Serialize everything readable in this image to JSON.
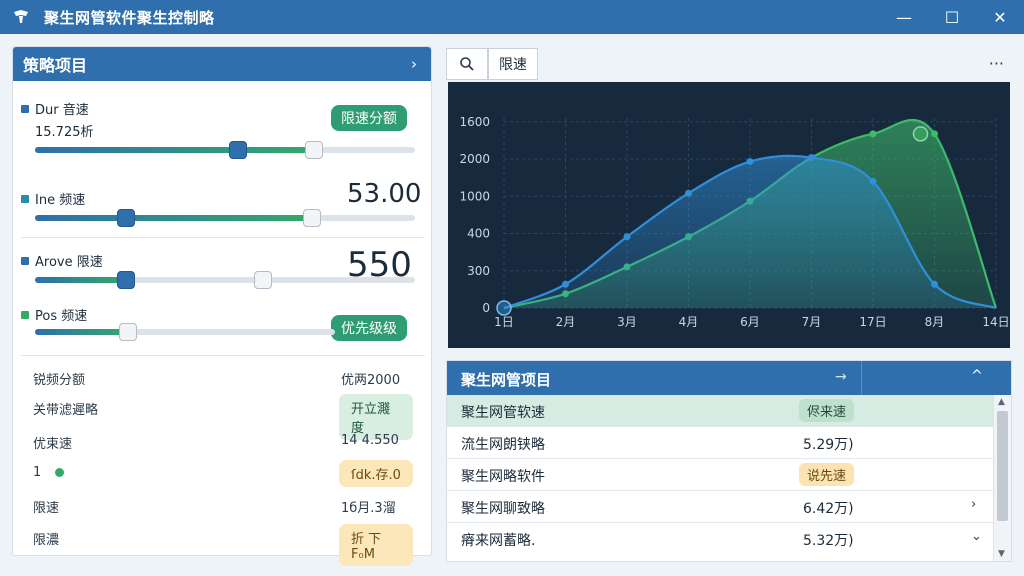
{
  "window": {
    "title": "聚生网管软件聚生控制略",
    "buttons": {
      "minimize": "—",
      "maximize": "☐",
      "close": "✕"
    }
  },
  "left": {
    "header": {
      "title": "策略项目",
      "chevron": "›"
    },
    "sliders": [
      {
        "label": "Dur 音速",
        "sublabel": "15.725析",
        "color": "#2f6fad",
        "value_fraction": 0.55,
        "thumb_fraction": 0.735,
        "badge": "限速分额"
      },
      {
        "label": "Ine 频速",
        "color": "#2a8fa0",
        "value_fraction": 0.73,
        "thumb_fraction": 0.24,
        "value_text": "53.00"
      },
      {
        "label": "Arove 限速",
        "color": "#2f6fad",
        "value_fraction": 0.24,
        "thumb_fraction": 0.6,
        "value_text": "550"
      },
      {
        "label": "Pos 频速",
        "color": "#35a86a",
        "value_fraction": 0.24,
        "badge": "优先级级"
      }
    ],
    "stats": [
      {
        "key": "锐频分额",
        "value": "优两2000"
      },
      {
        "key": "关带滤遲略",
        "tag": "开立濺度",
        "tag_color": "green"
      },
      {
        "key": "优束速",
        "value": "14 4.550"
      },
      {
        "key": "1",
        "tag": "ſdk.存.0",
        "tag_color": "amber",
        "has_dot": true
      },
      {
        "key": "限速",
        "value": "1б月.3溜"
      },
      {
        "key": "限濃",
        "tag": "折 下 F₀M",
        "tag_color": "amber"
      }
    ]
  },
  "chart_toolbar": {
    "search_icon": "search-icon",
    "tab_label": "限速",
    "more": "···"
  },
  "chart_data": {
    "type": "area",
    "x_ticks": [
      "1日",
      "2月",
      "3月",
      "4月",
      "6月",
      "7月",
      "17日",
      "8月",
      "14日"
    ],
    "y_ticks": [
      "0",
      "300",
      "400",
      "1000",
      "2000",
      "1600"
    ],
    "series": [
      {
        "color": "#2f8fd8",
        "values": [
          0,
          300,
          900,
          1450,
          1850,
          1900,
          1600,
          300,
          0
        ]
      },
      {
        "color": "#3dbb6a",
        "values": [
          0,
          180,
          520,
          900,
          1350,
          1900,
          2200,
          2200,
          0
        ]
      }
    ],
    "grid": true
  },
  "table": {
    "title": "聚生网管项目",
    "header_arrow": "→",
    "header_up": "^",
    "rows": [
      {
        "name": "聚生网管软速",
        "chip": "侭来速",
        "chip_color": "green",
        "selected": true
      },
      {
        "name": "流生网朗铗略",
        "value": "5.29万)"
      },
      {
        "name": "聚生网略软件",
        "chip": "说先速",
        "chip_color": "amber"
      },
      {
        "name": "聚生网聊致略",
        "value": "6.42万)",
        "chevron": "›"
      },
      {
        "name": "瘠来网蓄略.",
        "value": "5.32万)",
        "chevron": "⌄"
      }
    ]
  }
}
